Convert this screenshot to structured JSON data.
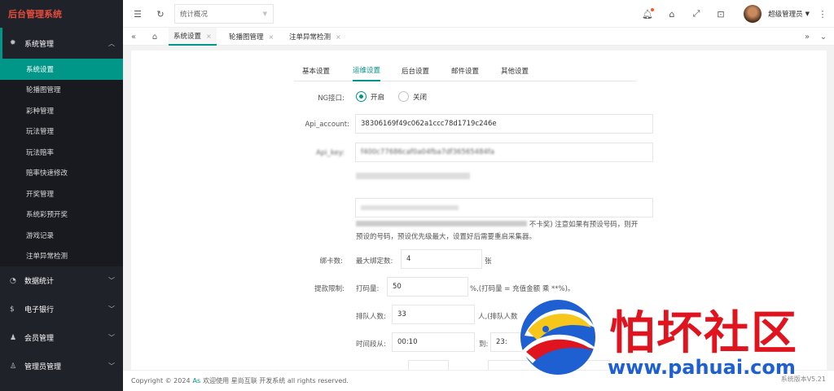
{
  "app": {
    "logo_text": "后台管理系统"
  },
  "sidebar": {
    "groups": [
      {
        "label": "系统管理",
        "icon": "gear-icon",
        "open": true
      },
      {
        "label": "数据统计",
        "icon": "dashboard-icon"
      },
      {
        "label": "电子银行",
        "icon": "dollar-icon"
      },
      {
        "label": "会员管理",
        "icon": "users-icon"
      },
      {
        "label": "管理员管理",
        "icon": "user-icon"
      }
    ],
    "sub_items": [
      "系统设置",
      "轮播图管理",
      "彩种管理",
      "玩法管理",
      "玩法赔率",
      "赔率快速修改",
      "开奖管理",
      "系统彩预开奖",
      "游戏记录",
      "注单异常检测"
    ]
  },
  "header": {
    "select_value": "统计概况",
    "user_name": "超级管理员"
  },
  "tabs": [
    {
      "label": "系统设置",
      "active": true
    },
    {
      "label": "轮播图管理"
    },
    {
      "label": "注单异常检测"
    }
  ],
  "content_tabs": [
    "基本设置",
    "运维设置",
    "后台设置",
    "邮件设置",
    "其他设置"
  ],
  "form": {
    "ng_label": "NG接口:",
    "radio_on": "开启",
    "radio_off": "关闭",
    "api_account_label": "Api_account:",
    "api_account_value": "38306169f49c062a1ccc78d1719c246e",
    "api_key_label": "Api_key:",
    "api_key_value": "f400c77686caf0a04fba7df36565484fa",
    "note_line1": "注意如果有预设号码，则开",
    "note_line1_prefix": "不卡奖)",
    "note_line2": "预设的号码，预设优先级最大，设置好后需要重启采集器。",
    "bind_label": "绑卡数:",
    "bind_sub_label": "最大绑定数:",
    "bind_value": "4",
    "bind_unit": "张",
    "withdraw_label": "提款限制:",
    "dama_label": "打码量:",
    "dama_value": "50",
    "dama_note": "%,(打码量 = 充值金额 乘 **%)。",
    "queue_label": "排队人数:",
    "queue_value": "33",
    "queue_note": "人,(排队人数",
    "time_label": "时间段从:",
    "time_from": "00:10",
    "time_to_label": "到:",
    "time_to": "23:"
  },
  "footer": {
    "copyright": "Copyright © 2024",
    "link": "As",
    "rest": "欢迎使用 星尚互联 开发系统 all rights reserved.",
    "version": "系统版本V5.21"
  },
  "watermark": {
    "title": "怕坏社区",
    "url": "www.pahuai.com"
  }
}
